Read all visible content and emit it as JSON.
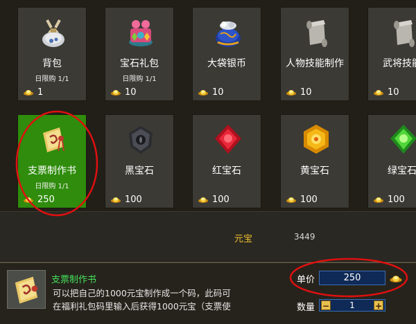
{
  "shop": {
    "items": [
      {
        "name": "背包",
        "limit": "日限购 1/1",
        "price": "1",
        "icon": "bag-icon"
      },
      {
        "name": "宝石礼包",
        "limit": "日限购 1/1",
        "price": "10",
        "icon": "gem-giftbox-icon"
      },
      {
        "name": "大袋银币",
        "limit": "",
        "price": "10",
        "icon": "silver-coin-bag-icon"
      },
      {
        "name": "人物技能制作",
        "limit": "",
        "price": "10",
        "icon": "scroll-icon"
      },
      {
        "name": "武将技能",
        "limit": "",
        "price": "10",
        "icon": "scroll-icon"
      },
      {
        "name": "支票制作书",
        "limit": "日限购 1/1",
        "price": "250",
        "icon": "cheque-book-icon"
      },
      {
        "name": "黑宝石",
        "limit": "",
        "price": "100",
        "icon": "black-gem-icon"
      },
      {
        "name": "红宝石",
        "limit": "",
        "price": "100",
        "icon": "red-gem-icon"
      },
      {
        "name": "黄宝石",
        "limit": "",
        "price": "100",
        "icon": "yellow-gem-icon"
      },
      {
        "name": "绿宝石",
        "limit": "",
        "price": "100",
        "icon": "green-gem-icon"
      }
    ]
  },
  "currency": {
    "label": "元宝",
    "value": "3449"
  },
  "selected": {
    "title": "支票制作书",
    "description_line1": "可以把自己的1000元宝制作成一个码，此码可",
    "description_line2": "在福利礼包码里输入后获得1000元宝（支票使",
    "unit_price_label": "单价",
    "unit_price": "250",
    "quantity_label": "数量",
    "quantity": "1",
    "minus": "−",
    "plus": "+"
  },
  "colors": {
    "selected_card": "#2f8c0c",
    "highlight_ring": "#e01010",
    "gold": "#f2c230"
  }
}
